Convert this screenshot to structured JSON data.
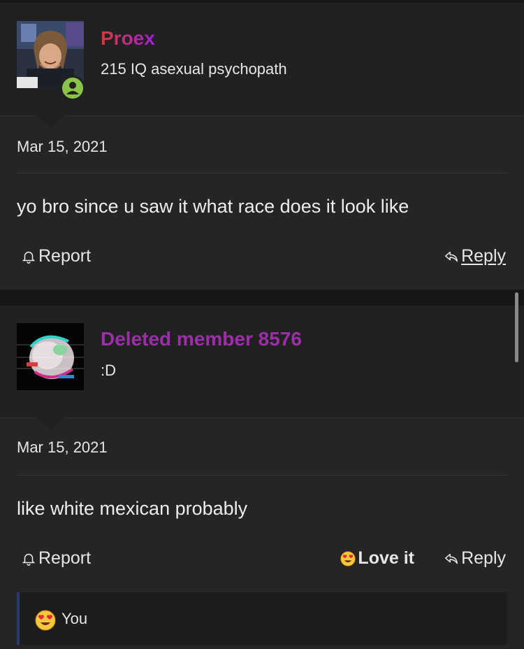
{
  "posts": [
    {
      "username": "Proex",
      "user_title": "215 IQ asexual psychopath",
      "date": "Mar 15, 2021",
      "message": "yo bro since u saw it what race does it look like",
      "report_label": "Report",
      "reply_label": "Reply",
      "online": true
    },
    {
      "username": "Deleted member 8576",
      "user_title": ":D",
      "date": "Mar 15, 2021",
      "message": "like white mexican probably",
      "report_label": "Report",
      "love_label": "Love it",
      "reply_label": "Reply",
      "reactions": {
        "label": "You",
        "emoji": "heart-eyes-emoji"
      }
    }
  ],
  "colors": {
    "page_bg": "#161616",
    "post_bg": "#252525",
    "header_bg": "#212121",
    "username_1_gradient": [
      "#d23a3a",
      "#a020d8"
    ],
    "username_2": "#9b2fa8",
    "online_badge": "#8bc34a",
    "reactions_accent": "#2b3a6b"
  }
}
